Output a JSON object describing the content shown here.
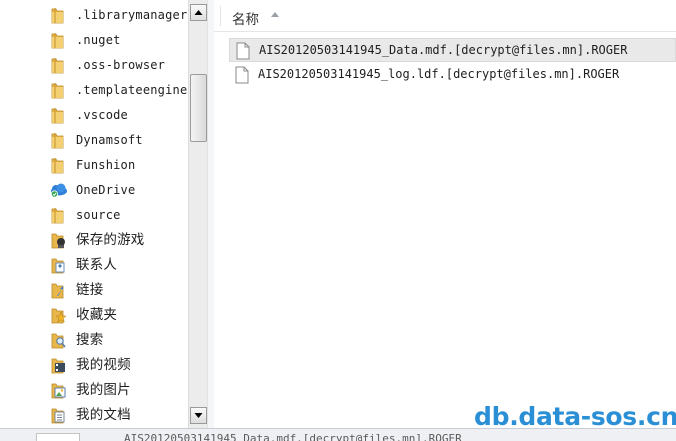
{
  "nav_tree": {
    "items": [
      {
        "label": ".librarymanager",
        "icon": "folder-icon"
      },
      {
        "label": ".nuget",
        "icon": "folder-icon"
      },
      {
        "label": ".oss-browser",
        "icon": "folder-icon"
      },
      {
        "label": ".templateengine",
        "icon": "folder-icon"
      },
      {
        "label": ".vscode",
        "icon": "folder-icon"
      },
      {
        "label": "Dynamsoft",
        "icon": "folder-icon"
      },
      {
        "label": "Funshion",
        "icon": "folder-icon"
      },
      {
        "label": "OneDrive",
        "icon": "onedrive-cloud-icon"
      },
      {
        "label": "source",
        "icon": "folder-icon"
      },
      {
        "label": "保存的游戏",
        "icon": "saved-games-icon"
      },
      {
        "label": "联系人",
        "icon": "contacts-icon"
      },
      {
        "label": "链接",
        "icon": "links-icon"
      },
      {
        "label": "收藏夹",
        "icon": "favorites-icon"
      },
      {
        "label": "搜索",
        "icon": "searches-icon"
      },
      {
        "label": "我的视频",
        "icon": "videos-icon"
      },
      {
        "label": "我的图片",
        "icon": "pictures-icon"
      },
      {
        "label": "我的文档",
        "icon": "documents-icon"
      }
    ]
  },
  "file_list": {
    "column_name_label": "名称",
    "sort": "ascending",
    "files": [
      {
        "name": "AIS20120503141945_Data.mdf.[decrypt@files.mn].ROGER",
        "icon": "file-icon",
        "selected": true
      },
      {
        "name": "AIS20120503141945_log.ldf.[decrypt@files.mn].ROGER",
        "icon": "file-icon",
        "selected": false
      }
    ]
  },
  "details_strip": {
    "text": "AIS20120503141945_Data.mdf.[decrypt@files.mn].ROGER"
  },
  "watermark": "db.data-sos.cn",
  "colors": {
    "folder": "#e8b64a",
    "watermark": "#2b8fd6",
    "selection": "#e9e9e9",
    "onedrive": "#2f7fd6"
  }
}
